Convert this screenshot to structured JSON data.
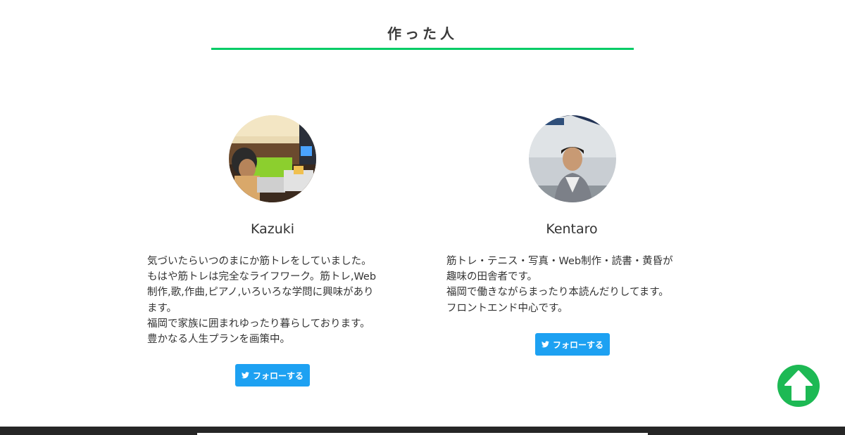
{
  "section": {
    "title": "作った人"
  },
  "colors": {
    "accent_underline": "#00cc66",
    "twitter_blue": "#1da1f2",
    "scroll_top_green": "#1db954",
    "footer_dark": "#262626"
  },
  "members": [
    {
      "name": "Kazuki",
      "bio_lines": [
        "気づいたらいつのまにか筋トレをしていました。",
        "もはや筋トレは完全なライフワーク。筋トレ,Web",
        "制作,歌,作曲,ピアノ,いろいろな学問に興味があり",
        "ます。",
        "福岡で家族に囲まれゆったり暮らしております。",
        "豊かなる人生プランを画策中。"
      ],
      "follow_label": "フォローする",
      "follow_icon": "twitter-icon"
    },
    {
      "name": "Kentaro",
      "bio_lines": [
        "筋トレ・テニス・写真・Web制作・読書・黄昏が",
        "趣味の田舎者です。",
        "福岡で働きながらまったり本読んだりしてます。",
        "フロントエンド中心です。"
      ],
      "follow_label": "フォローする",
      "follow_icon": "twitter-icon"
    }
  ],
  "scroll_top": {
    "icon": "arrow-up-icon"
  }
}
